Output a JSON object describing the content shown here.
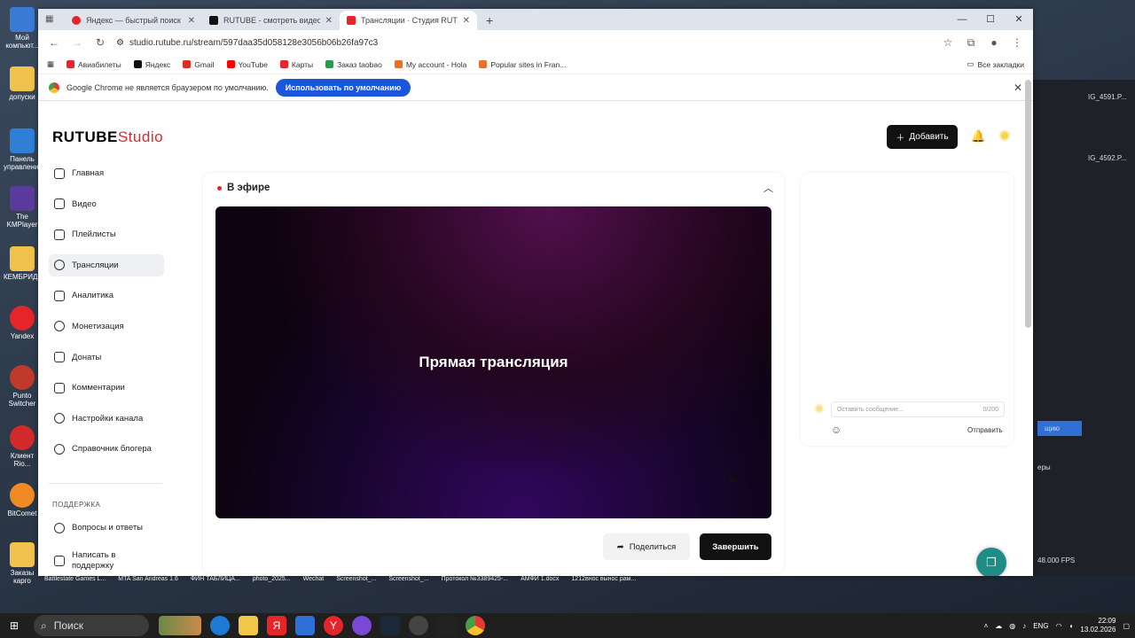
{
  "desktop": {
    "icons": [
      {
        "label": "Мой компьют...",
        "color": "#3a7bd5"
      },
      {
        "label": "допуски",
        "color": "#f0c24b"
      },
      {
        "label": "Панель управлени...",
        "color": "#2f7fd6"
      },
      {
        "label": "The KMPlayer",
        "color": "#5b3a9e"
      },
      {
        "label": "КЕМБРИДЖ",
        "color": "#f0c24b"
      },
      {
        "label": "Yandex",
        "color": "#e5252a"
      },
      {
        "label": "Punto Switcher",
        "color": "#c0392b"
      },
      {
        "label": "Клиент Rio...",
        "color": "#d02a2a"
      },
      {
        "label": "BitComet",
        "color": "#f08a24"
      },
      {
        "label": "Заказы карго",
        "color": "#f0c24b"
      }
    ],
    "right_texts": [
      "IG_4591.P...",
      "IG_4592.P...",
      "щию",
      "еры",
      "48.000 FPS"
    ],
    "files": [
      "Battlestate Games L...",
      "MTA San Andreas 1.6",
      "ФИН ТАБЛИЦА...",
      "photo_2025...",
      "Wechat",
      "Screenshot_...",
      "Screenshot_...",
      "Протокол №3389425-...",
      "АМФИ 1.docx",
      "1212внос вынос рам..."
    ]
  },
  "taskbar": {
    "search_label": "Поиск",
    "lang": "ENG",
    "time": "22:09",
    "date": "13.02.2026"
  },
  "browser": {
    "tabs": [
      {
        "title": "Яндекс — быстрый поиск в ин",
        "color": "#e5252a"
      },
      {
        "title": "RUTUBE - смотреть видео онл",
        "color": "#111"
      },
      {
        "title": "Трансляции · Студия RUTUBE",
        "color": "#e5252a"
      }
    ],
    "url": "studio.rutube.ru/stream/597daa35d058128e3056b06b26fa97c3",
    "bookmarks": [
      {
        "label": "Авиабилеты",
        "color": "#e5252a"
      },
      {
        "label": "Яндекс",
        "color": "#111"
      },
      {
        "label": "Gmail",
        "color": "#d93025"
      },
      {
        "label": "YouTube",
        "color": "#ff0000"
      },
      {
        "label": "Карты",
        "color": "#e5252a"
      },
      {
        "label": "Заказ taobao",
        "color": "#2d9a4a"
      },
      {
        "label": "My account - Hola",
        "color": "#e8702a"
      },
      {
        "label": "Popular sites in Fran...",
        "color": "#e8702a"
      }
    ],
    "all_bookmarks": "Все закладки",
    "infobar_text": "Google Chrome не является браузером по умолчанию.",
    "infobar_button": "Использовать по умолчанию"
  },
  "studio": {
    "logo_main": "RUTUBE",
    "logo_sub": "Studio",
    "add_button": "Добавить",
    "sidebar": [
      {
        "label": "Главная",
        "active": false
      },
      {
        "label": "Видео",
        "active": false
      },
      {
        "label": "Плейлисты",
        "active": false
      },
      {
        "label": "Трансляции",
        "active": true
      },
      {
        "label": "Аналитика",
        "active": false
      },
      {
        "label": "Монетизация",
        "active": false
      },
      {
        "label": "Донаты",
        "active": false
      },
      {
        "label": "Комментарии",
        "active": false
      },
      {
        "label": "Настройки канала",
        "active": false
      },
      {
        "label": "Справочник блогера",
        "active": false
      }
    ],
    "support_title": "ПОДДЕРЖКА",
    "support": [
      {
        "label": "Вопросы и ответы"
      },
      {
        "label": "Написать в поддержку"
      }
    ],
    "live": {
      "title": "В эфире",
      "video_caption": "Прямая трансляция",
      "share_button": "Поделиться",
      "finish_button": "Завершить"
    },
    "chat": {
      "placeholder": "Оставить сообщение...",
      "counter": "0/200",
      "send": "Отправить"
    }
  }
}
